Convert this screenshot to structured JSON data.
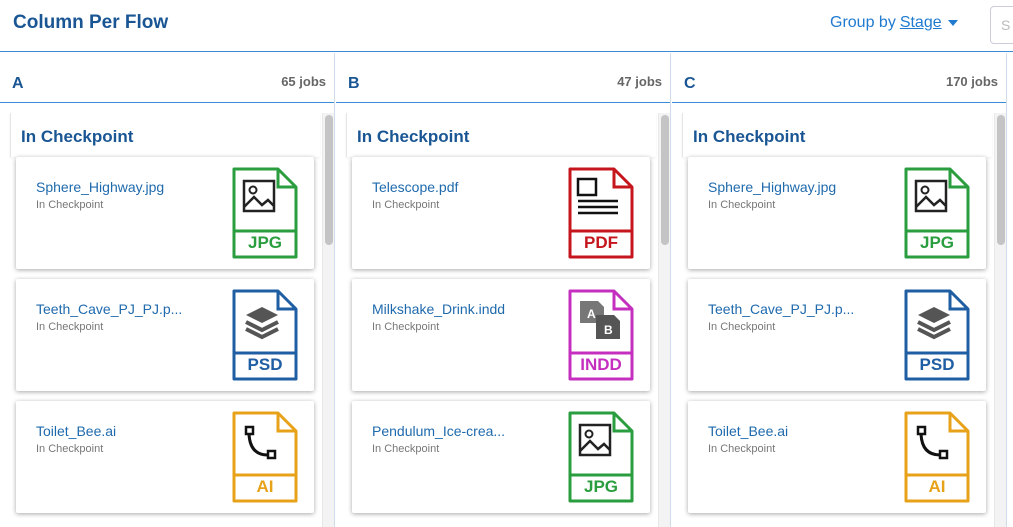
{
  "header": {
    "title": "Column Per Flow",
    "group_by_label": "Group by",
    "group_by_value": "Stage",
    "search_placeholder": "S"
  },
  "columns": [
    {
      "name": "A",
      "count": "65 jobs",
      "stage": "In Checkpoint",
      "cards": [
        {
          "name": "Sphere_Highway.jpg",
          "status": "In Checkpoint",
          "type": "JPG",
          "color": "#2a9d3f",
          "icon": "image-file-icon"
        },
        {
          "name": "Teeth_Cave_PJ_PJ.p...",
          "status": "In Checkpoint",
          "type": "PSD",
          "color": "#1f5ea3",
          "icon": "layers-file-icon"
        },
        {
          "name": "Toilet_Bee.ai",
          "status": "In Checkpoint",
          "type": "AI",
          "color": "#e7a21a",
          "icon": "vector-file-icon"
        }
      ]
    },
    {
      "name": "B",
      "count": "47 jobs",
      "stage": "In Checkpoint",
      "cards": [
        {
          "name": "Telescope.pdf",
          "status": "In Checkpoint",
          "type": "PDF",
          "color": "#c4161c",
          "icon": "document-file-icon"
        },
        {
          "name": "Milkshake_Drink.indd",
          "status": "In Checkpoint",
          "type": "INDD",
          "color": "#c52fbf",
          "icon": "indesign-file-icon"
        },
        {
          "name": "Pendulum_Ice-crea...",
          "status": "In Checkpoint",
          "type": "JPG",
          "color": "#2a9d3f",
          "icon": "image-file-icon"
        }
      ]
    },
    {
      "name": "C",
      "count": "170 jobs",
      "stage": "In Checkpoint",
      "cards": [
        {
          "name": "Sphere_Highway.jpg",
          "status": "In Checkpoint",
          "type": "JPG",
          "color": "#2a9d3f",
          "icon": "image-file-icon"
        },
        {
          "name": "Teeth_Cave_PJ_PJ.p...",
          "status": "In Checkpoint",
          "type": "PSD",
          "color": "#1f5ea3",
          "icon": "layers-file-icon"
        },
        {
          "name": "Toilet_Bee.ai",
          "status": "In Checkpoint",
          "type": "AI",
          "color": "#e7a21a",
          "icon": "vector-file-icon"
        }
      ]
    }
  ]
}
